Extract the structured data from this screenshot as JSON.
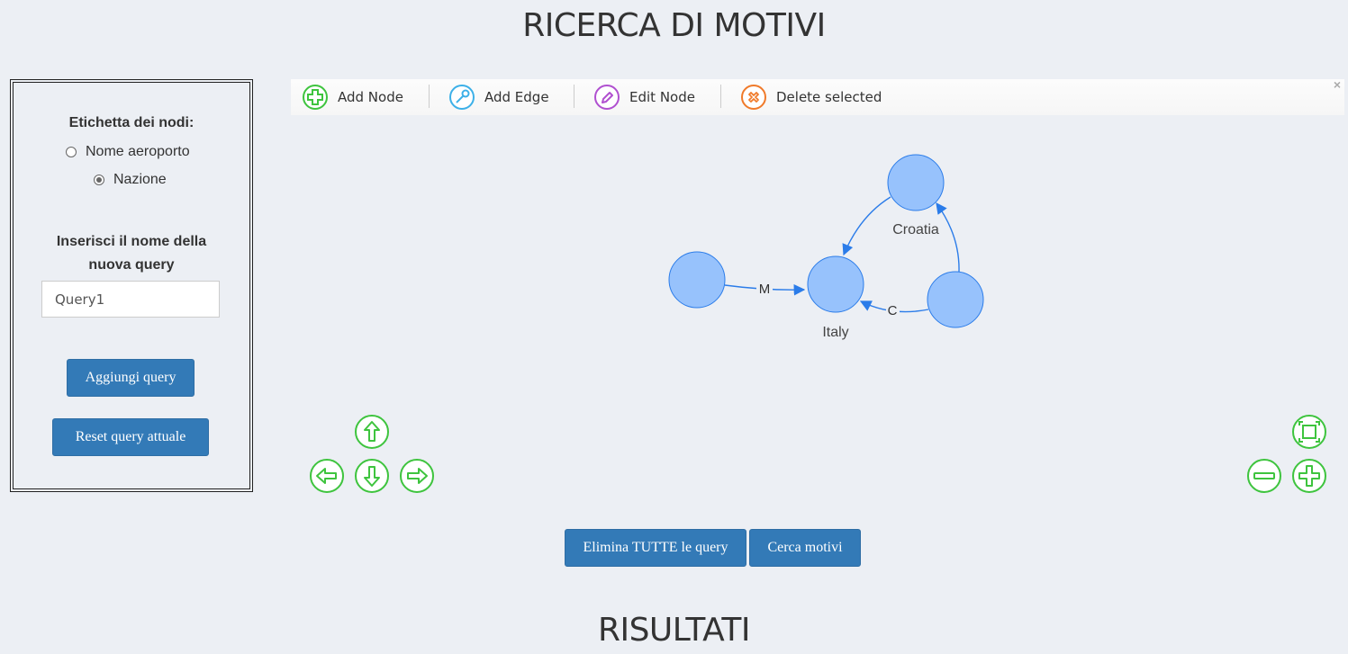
{
  "header": {
    "title": "RICERCA DI MOTIVI"
  },
  "results": {
    "title": "RISULTATI"
  },
  "sidebar": {
    "node_label_heading": "Etichetta dei nodi:",
    "radio_options": [
      {
        "label": "Nome aeroporto",
        "checked": false
      },
      {
        "label": "Nazione",
        "checked": true
      }
    ],
    "query_name_heading_line1": "Inserisci il nome della",
    "query_name_heading_line2": "nuova query",
    "query_input_value": "Query1",
    "add_query_label": "Aggiungi query",
    "reset_query_label": "Reset query attuale"
  },
  "toolbar": {
    "add_node": "Add Node",
    "add_edge": "Add Edge",
    "edit_node": "Edit Node",
    "delete_selected": "Delete selected",
    "close_symbol": "×"
  },
  "graph": {
    "node_color": "#97c2fc",
    "node_border": "#2b7ce9",
    "edge_color": "#2b7ce9",
    "nodes": [
      {
        "id": "n1",
        "label": ""
      },
      {
        "id": "italy",
        "label": "Italy"
      },
      {
        "id": "croatia",
        "label": "Croatia"
      },
      {
        "id": "n4",
        "label": ""
      }
    ],
    "edges": [
      {
        "from": "n1",
        "to": "italy",
        "label": "M"
      },
      {
        "from": "croatia",
        "to": "italy",
        "label": ""
      },
      {
        "from": "n4",
        "to": "croatia",
        "label": ""
      },
      {
        "from": "n4",
        "to": "italy",
        "label": "C"
      }
    ]
  },
  "navigation": {
    "icon_color": "#3ec43e",
    "icons": [
      "arrow-up-icon",
      "arrow-left-icon",
      "arrow-down-icon",
      "arrow-right-icon",
      "zoom-out-icon",
      "zoom-in-icon",
      "fit-icon"
    ]
  },
  "actions": {
    "delete_all_label": "Elimina TUTTE le query",
    "search_label": "Cerca motivi"
  }
}
